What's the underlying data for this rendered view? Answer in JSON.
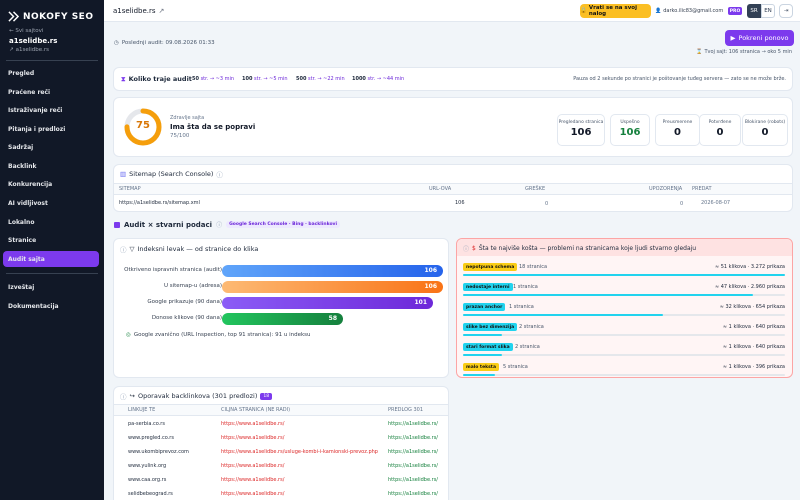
{
  "brand": {
    "name": "NOKOFY SEO"
  },
  "sidebar": {
    "back_label": "← Svi sajtovi",
    "site_name": "a1selidbe.rs",
    "site_link": "a1selidbe.rs",
    "items": [
      {
        "label": "Pregled"
      },
      {
        "label": "Praćene reči"
      },
      {
        "label": "Istraživanje reči"
      },
      {
        "label": "Pitanja i predlozi"
      },
      {
        "label": "Sadržaj"
      },
      {
        "label": "Backlink"
      },
      {
        "label": "Konkurencija"
      },
      {
        "label": "AI vidljivost"
      },
      {
        "label": "Lokalno"
      },
      {
        "label": "Stranice"
      },
      {
        "label": "Audit sajta"
      }
    ],
    "bottom": [
      {
        "label": "Izveštaj"
      },
      {
        "label": "Dokumentacija"
      }
    ]
  },
  "topbar": {
    "site": "a1selidbe.rs",
    "return_btn": "Vrati se na svoj nalog",
    "email": "darko.ilic83@gmail.com",
    "plan": "PRO",
    "lang": [
      "SR",
      "EN"
    ]
  },
  "audit": {
    "last_audit": "Poslednji audit: 09.08.2026 01:33",
    "rerun_btn": "Pokreni ponovo",
    "site_note": "Tvoj sajt: 106 stranica → oko 5 min"
  },
  "duration": {
    "title": "Koliko traje audit",
    "items": [
      {
        "n": "50",
        "t": "str. → ~3 min"
      },
      {
        "n": "100",
        "t": "str. → ~5 min"
      },
      {
        "n": "500",
        "t": "str. → ~22 min"
      },
      {
        "n": "1000",
        "t": "str. → ~44 min"
      }
    ],
    "note": "Pauza od 2 sekunde po stranici je poštovanje tuđeg servera — zato se ne može brže."
  },
  "health": {
    "score": "75",
    "title": "Zdravlje sajta",
    "status": "Ima šta da se popravi",
    "ratio": "75/100",
    "score_value": 75
  },
  "stats": [
    {
      "label": "Pregledano stranica",
      "value": "106"
    },
    {
      "label": "Uspešno",
      "value": "106"
    },
    {
      "label": "Preusmerene",
      "value": "0"
    },
    {
      "label": "Potvrđene",
      "value": "0"
    },
    {
      "label": "Blokirane (robots)",
      "value": "0"
    }
  ],
  "sitemap": {
    "title": "Sitemap (Search Console)",
    "headers": [
      "SITEMAP",
      "URL-OVA",
      "GREŠKE",
      "UPOZORENJA",
      "PREDAT"
    ],
    "rows": [
      [
        "https://a1selidbe.rs/sitemap.xml",
        "106",
        "0",
        "0",
        "2026-08-07"
      ]
    ]
  },
  "section": {
    "title": "Audit × stvarni podaci",
    "badge": "Google Search Console · Bing · backlinkovi"
  },
  "funnel": {
    "title": "Indeksni levak — od stranice do klika",
    "rows": [
      {
        "label": "Otkriveno ispravnih stranica (audit)",
        "value": "106",
        "num": 106,
        "color": "#3b82f6"
      },
      {
        "label": "U sitemap-u (adresa)",
        "value": "106",
        "num": 106,
        "color": "#fb923c"
      },
      {
        "label": "Google prikazuje (90 dana)",
        "value": "101",
        "num": 101,
        "color": "#7c3aed"
      },
      {
        "label": "Donose klikove (90 dana)",
        "value": "58",
        "num": 58,
        "color": "#15803d"
      }
    ],
    "note": "Google zvanično (URL Inspection, top 91 stranica): 91 u indeksu"
  },
  "problems": {
    "title": "Šta te najviše košta — problemi na stranicama koje ljudi stvarno gledaju",
    "rows": [
      {
        "tag": "nepotpuna schema",
        "color": "#facc15",
        "count": "18 stranica",
        "value": "≈ 51 klikova · 3.272 prikaza",
        "fill": 1.0
      },
      {
        "tag": "nedostaje interni",
        "color": "#22d3ee",
        "count": "1 stranica",
        "value": "≈ 47 klikova · 2.960 prikaza",
        "fill": 0.9
      },
      {
        "tag": "prazan anchor",
        "color": "#22d3ee",
        "count": "1 stranica",
        "value": "≈ 32 klikova · 654 prikaza",
        "fill": 0.62
      },
      {
        "tag": "slike bez dimenzija",
        "color": "#22d3ee",
        "count": "2 stranica",
        "value": "≈ 1 klikova · 640 prikaza",
        "fill": 0.12
      },
      {
        "tag": "stari format slika",
        "color": "#22d3ee",
        "count": "2 stranica",
        "value": "≈ 1 klikova · 640 prikaza",
        "fill": 0.12
      },
      {
        "tag": "malo teksta",
        "color": "#facc15",
        "count": "5 stranica",
        "value": "≈ 1 klikova · 396 prikaza",
        "fill": 0.1
      }
    ]
  },
  "backlinks": {
    "title": "Oporavak backlinkova (301 predlozi)",
    "count": "18",
    "headers": [
      "LINKUJE TE",
      "CILJNA STRANICA (NE RADI)",
      "PREDLOG 301"
    ],
    "rows": [
      [
        "pa-serbia.co.rs",
        "https://www.a1selidbe.rs/",
        "https://a1selidbe.rs/"
      ],
      [
        "www.pregled.co.rs",
        "https://www.a1selidbe.rs/",
        "https://a1selidbe.rs/"
      ],
      [
        "www.ukombiprevoz.com",
        "https://www.a1selidbe.rs/usluge-kombi-i-kamionski-prevoz.php",
        "https://a1selidbe.rs/"
      ],
      [
        "www.yulink.org",
        "https://www.a1selidbe.rs/",
        "https://a1selidbe.rs/"
      ],
      [
        "www.caa.org.rs",
        "https://www.a1selidbe.rs/",
        "https://a1selidbe.rs/"
      ],
      [
        "selidbebeograd.rs",
        "https://www.a1selidbe.rs/",
        "https://a1selidbe.rs/"
      ]
    ]
  },
  "colors": {
    "accent": "#7c3aed",
    "sidebar": "#111827",
    "score": "#f59e0b",
    "success": "#15803d",
    "link_red": "#dc2626",
    "link_green": "#15803d"
  }
}
